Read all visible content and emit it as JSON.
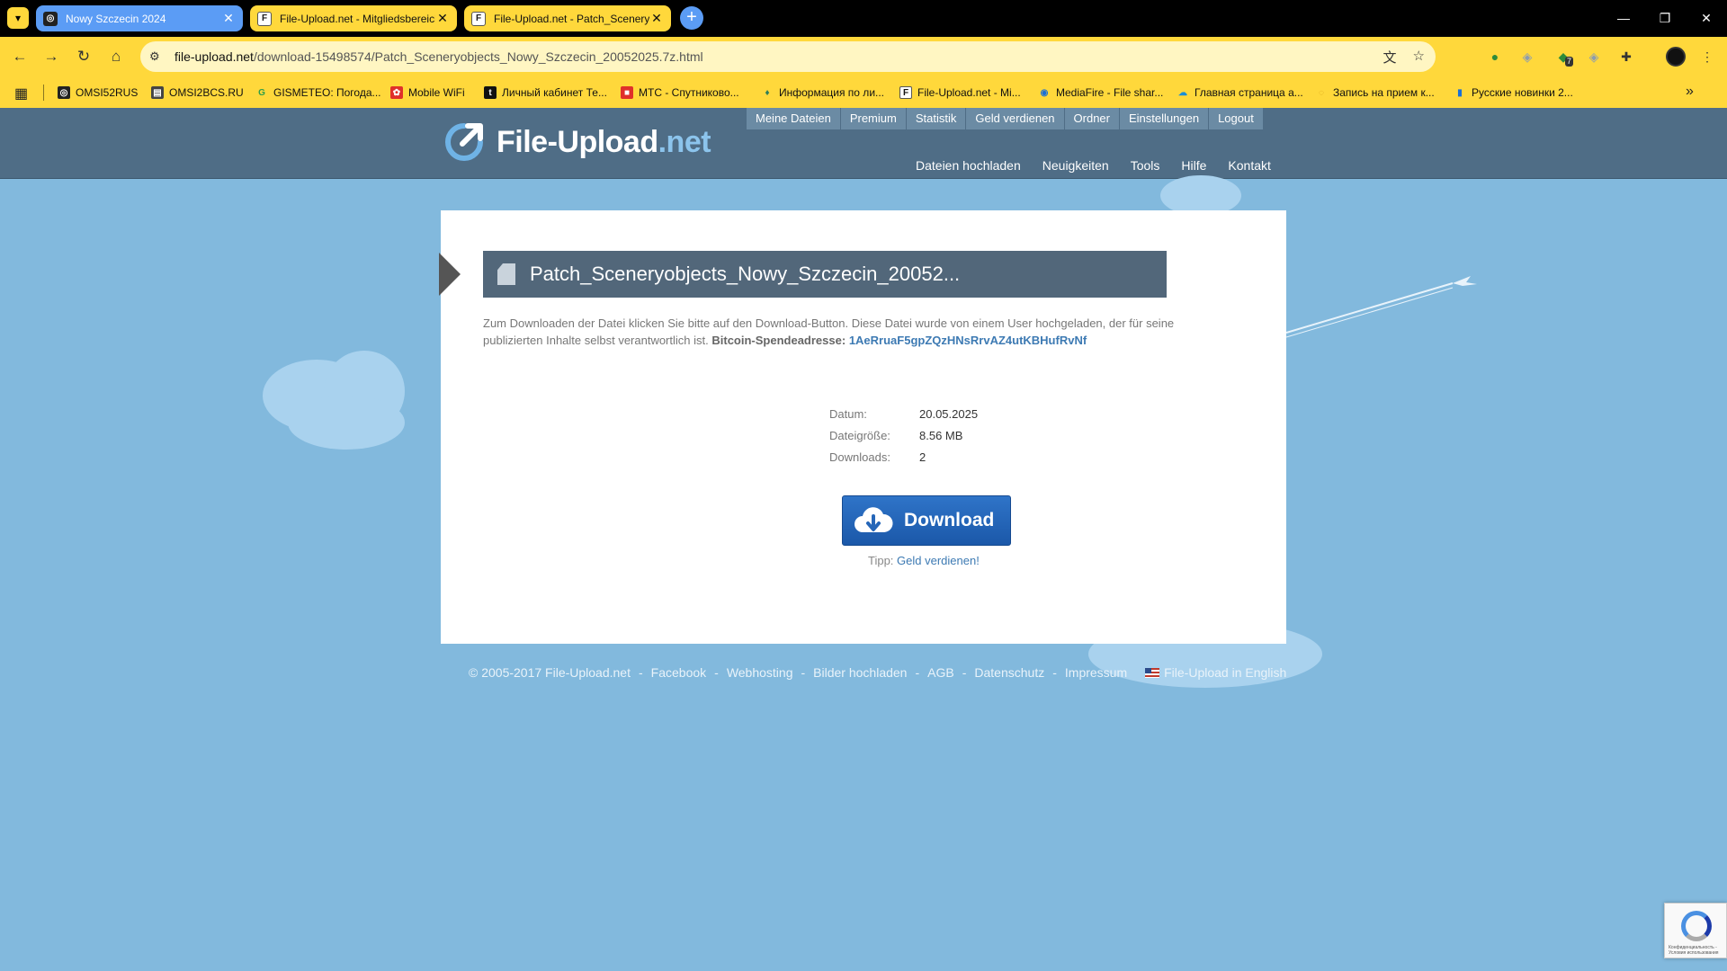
{
  "browser": {
    "tabs": [
      {
        "title": "Nowy Szczecin 2024",
        "active": false
      },
      {
        "title": "File-Upload.net - Mitgliedsbereich",
        "active": false
      },
      {
        "title": "File-Upload.net - Patch_Sceneryobjects",
        "active": true
      }
    ],
    "url_host": "file-upload.net",
    "url_path": "/download-15498574/Patch_Sceneryobjects_Nowy_Szczecin_20052025.7z.html",
    "bookmarks": [
      "OMSI52RUS",
      "OMSI2BCS.RU",
      "GISMETEO: Погода...",
      "Mobile WiFi",
      "Личный кабинет Те...",
      "МТС - Спутниково...",
      "Информация по ли...",
      "File-Upload.net - Mi...",
      "MediaFire - File shar...",
      "Главная страница а...",
      "Запись на прием к...",
      "Русские новинки 2..."
    ],
    "extension_badge": "7"
  },
  "site": {
    "logo_main": "File-Upload",
    "logo_tld": ".net",
    "topnav": [
      "Meine Dateien",
      "Premium",
      "Statistik",
      "Geld verdienen",
      "Ordner",
      "Einstellungen",
      "Logout"
    ],
    "mainnav": [
      "Dateien hochladen",
      "Neuigkeiten",
      "Tools",
      "Hilfe",
      "Kontakt"
    ]
  },
  "file": {
    "title": "Patch_Sceneryobjects_Nowy_Szczecin_20052...",
    "description": "Zum Downloaden der Datei klicken Sie bitte auf den Download-Button. Diese Datei wurde von einem User hochgeladen, der für seine publizierten Inhalte selbst verantwortlich ist. ",
    "bitcoin_label": "Bitcoin-Spendeadresse:",
    "bitcoin_address": "1AeRruaF5gpZQzHNsRrvAZ4utKBHufRvNf",
    "meta": [
      {
        "key": "Datum:",
        "value": "20.05.2025"
      },
      {
        "key": "Dateigröße:",
        "value": "8.56 MB"
      },
      {
        "key": "Downloads:",
        "value": "2"
      }
    ],
    "download_label": "Download",
    "tip_label": "Tipp:",
    "tip_link": "Geld verdienen!"
  },
  "footer": {
    "copyright": "© 2005-2017 File-Upload.net",
    "links": [
      "Facebook",
      "Webhosting",
      "Bilder hochladen",
      "AGB",
      "Datenschutz",
      "Impressum"
    ],
    "english": "File-Upload in English"
  },
  "recaptcha_text": "Конфиденциальность - Условия использования"
}
